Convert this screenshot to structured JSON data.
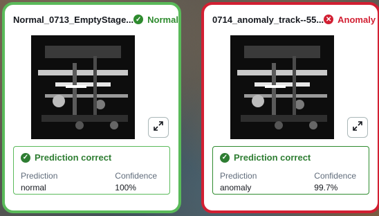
{
  "cards": [
    {
      "filename": "Normal_0713_EmptyStage...",
      "status_label": "Normal",
      "status_icon": "check-circle-icon",
      "status_color": "#2e8b2e",
      "border_color": "#5aba5a",
      "result_label": "Prediction correct",
      "prediction_header": "Prediction",
      "prediction_value": "normal",
      "confidence_header": "Confidence",
      "confidence_value": "100%"
    },
    {
      "filename": "0714_anomaly_track--55...",
      "status_label": "Anomaly",
      "status_icon": "x-circle-icon",
      "status_color": "#d21f32",
      "border_color": "#d21f32",
      "result_label": "Prediction correct",
      "prediction_header": "Prediction",
      "prediction_value": "anomaly",
      "confidence_header": "Confidence",
      "confidence_value": "99.7%"
    }
  ]
}
